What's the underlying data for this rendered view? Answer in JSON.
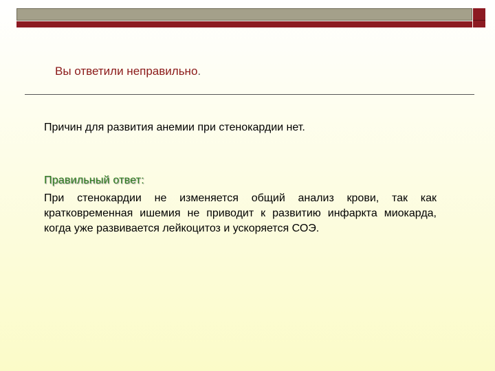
{
  "header": {
    "accent_gray": "#a4a08a",
    "accent_red": "#8c1a22"
  },
  "feedback": {
    "title": "Вы ответили неправильно",
    "title_punct": ".",
    "title_color": "#8b1a1a"
  },
  "content": {
    "reason": "Причин для развития анемии при стенокардии нет.",
    "correct_label": "Правильный ответ:",
    "correct_label_color": "#2e7d1e",
    "correct_text": "При стенокардии не изменяется общий анализ крови, так как кратковременная ишемия не приводит к развитию инфаркта миокарда, когда уже развивается лейкоцитоз и ускоряется СОЭ."
  }
}
